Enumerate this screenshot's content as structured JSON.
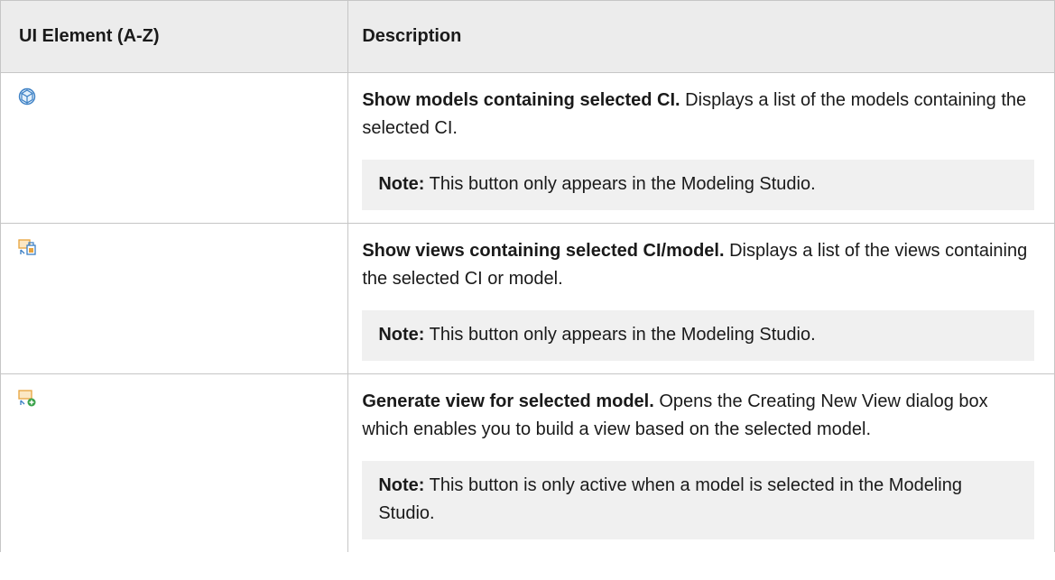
{
  "table": {
    "headers": {
      "ui_element": "UI Element (A-Z)",
      "description": "Description"
    },
    "rows": [
      {
        "icon": "models-cube-icon",
        "title": "Show models containing selected CI.",
        "text": " Displays a list of the models containing the selected CI.",
        "note_label": "Note:",
        "note_text": " This button only appears in the Modeling Studio."
      },
      {
        "icon": "views-containing-icon",
        "title": "Show views containing selected CI/model.",
        "text": " Displays a list of the views containing the selected CI or model.",
        "note_label": "Note:",
        "note_text": " This button only appears in the Modeling Studio."
      },
      {
        "icon": "generate-view-icon",
        "title": "Generate view for selected model.",
        "text": " Opens the Creating New View dialog box which enables you to build a view based on the selected model.",
        "note_label": "Note:",
        "note_text": " This button is only active when a model is selected in the Modeling Studio."
      }
    ]
  },
  "colors": {
    "header_bg": "#ececec",
    "note_bg": "#f0f0f0",
    "border": "#c6c6c6",
    "icon_blue": "#3b7fc4",
    "icon_orange": "#e8a33d",
    "icon_green": "#3aa24a"
  }
}
